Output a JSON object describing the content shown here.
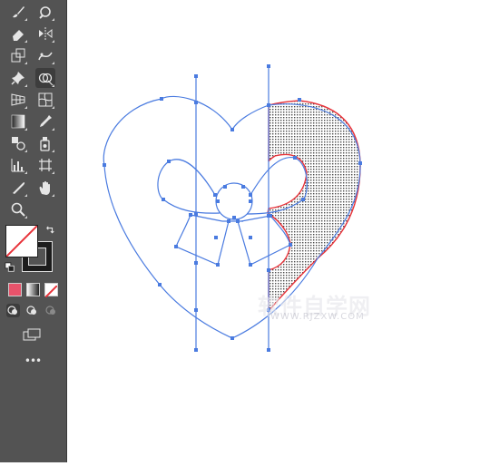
{
  "toolbar": {
    "tools": [
      {
        "name": "paintbrush-tool",
        "icon": "paintbrush-icon"
      },
      {
        "name": "blob-brush-tool",
        "icon": "blob-brush-icon"
      },
      {
        "name": "eraser-tool",
        "icon": "eraser-icon"
      },
      {
        "name": "reflect-tool",
        "icon": "reflect-icon"
      },
      {
        "name": "free-transform-tool",
        "icon": "free-transform-icon"
      },
      {
        "name": "puppet-warp-tool",
        "icon": "puppet-warp-icon"
      },
      {
        "name": "pin-tool",
        "icon": "pin-icon"
      },
      {
        "name": "shape-builder-tool",
        "icon": "shape-builder-icon",
        "selected": true
      },
      {
        "name": "perspective-grid-tool",
        "icon": "perspective-grid-icon"
      },
      {
        "name": "mesh-tool",
        "icon": "mesh-icon"
      },
      {
        "name": "gradient-tool",
        "icon": "gradient-icon"
      },
      {
        "name": "eyedropper-tool",
        "icon": "eyedropper-icon"
      },
      {
        "name": "blend-tool",
        "icon": "blend-icon"
      },
      {
        "name": "symbol-sprayer-tool",
        "icon": "symbol-sprayer-icon"
      },
      {
        "name": "column-graph-tool",
        "icon": "column-graph-icon"
      },
      {
        "name": "artboard-tool",
        "icon": "artboard-icon"
      },
      {
        "name": "slice-tool",
        "icon": "slice-icon"
      },
      {
        "name": "hand-tool",
        "icon": "hand-icon"
      },
      {
        "name": "zoom-tool",
        "icon": "zoom-icon"
      }
    ],
    "fill_stroke": {
      "fill": "none",
      "stroke": "#1c1c1c",
      "swap_icon": "swap-arrow-icon",
      "default_icon": "default-colors-icon"
    },
    "color_modes": [
      {
        "name": "color-mode-button",
        "color": "#e8536b"
      },
      {
        "name": "gradient-mode-button",
        "color": "#888888"
      },
      {
        "name": "none-mode-button",
        "color": "#ffffff"
      }
    ],
    "draw_modes": [
      "draw-normal-icon",
      "draw-behind-icon",
      "draw-inside-icon"
    ],
    "screen_mode_icon": "screen-mode-icon",
    "more_tools_label": "•••"
  },
  "canvas": {
    "path_color": "#4a7be0",
    "highlight_color": "#e8333a",
    "hatch_color": "#555555",
    "watermark": "软件自学网",
    "watermark_sub": "WWW.RJZXW.COM"
  }
}
